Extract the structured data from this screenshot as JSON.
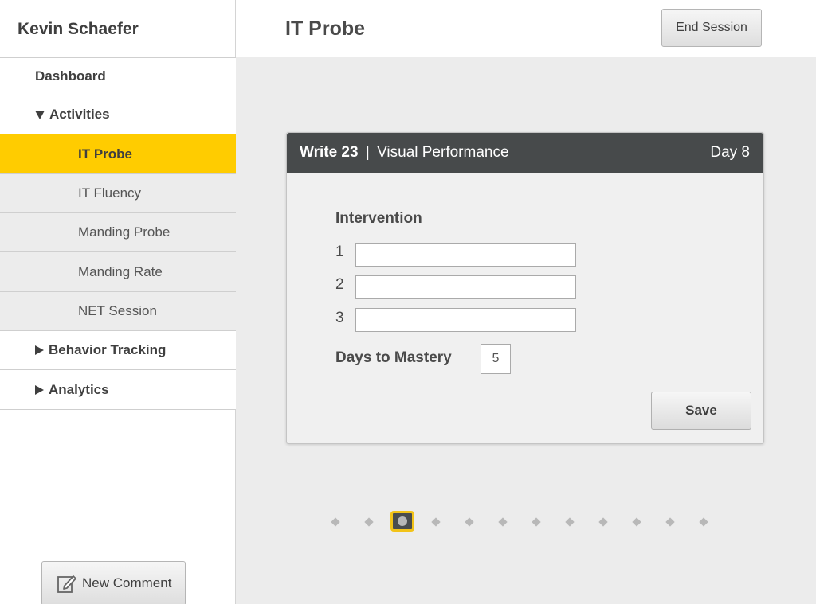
{
  "sidebar": {
    "user_name": "Kevin Schaefer",
    "dashboard": "Dashboard",
    "activities": "Activities",
    "items": [
      {
        "label": "IT Probe",
        "active": true
      },
      {
        "label": "IT Fluency",
        "active": false
      },
      {
        "label": "Manding Probe",
        "active": false
      },
      {
        "label": "Manding Rate",
        "active": false
      },
      {
        "label": "NET Session",
        "active": false
      }
    ],
    "behavior_tracking": "Behavior Tracking",
    "analytics": "Analytics",
    "new_comment": "New Comment",
    "new_comment_icon": "edit-icon"
  },
  "header": {
    "title": "IT Probe",
    "end_session": "End Session"
  },
  "card": {
    "code": "Write 23",
    "separator": "|",
    "subtitle": "Visual Performance",
    "day": "Day 8",
    "section_title": "Intervention",
    "rows": [
      {
        "num": "1",
        "value": ""
      },
      {
        "num": "2",
        "value": ""
      },
      {
        "num": "3",
        "value": ""
      }
    ],
    "mastery_label": "Days to Mastery",
    "mastery_value": "5",
    "save": "Save"
  },
  "pager": {
    "total": 12,
    "current": 3
  },
  "colors": {
    "accent": "#ffcc00",
    "card_header": "#474a4b",
    "background": "#ececec"
  }
}
